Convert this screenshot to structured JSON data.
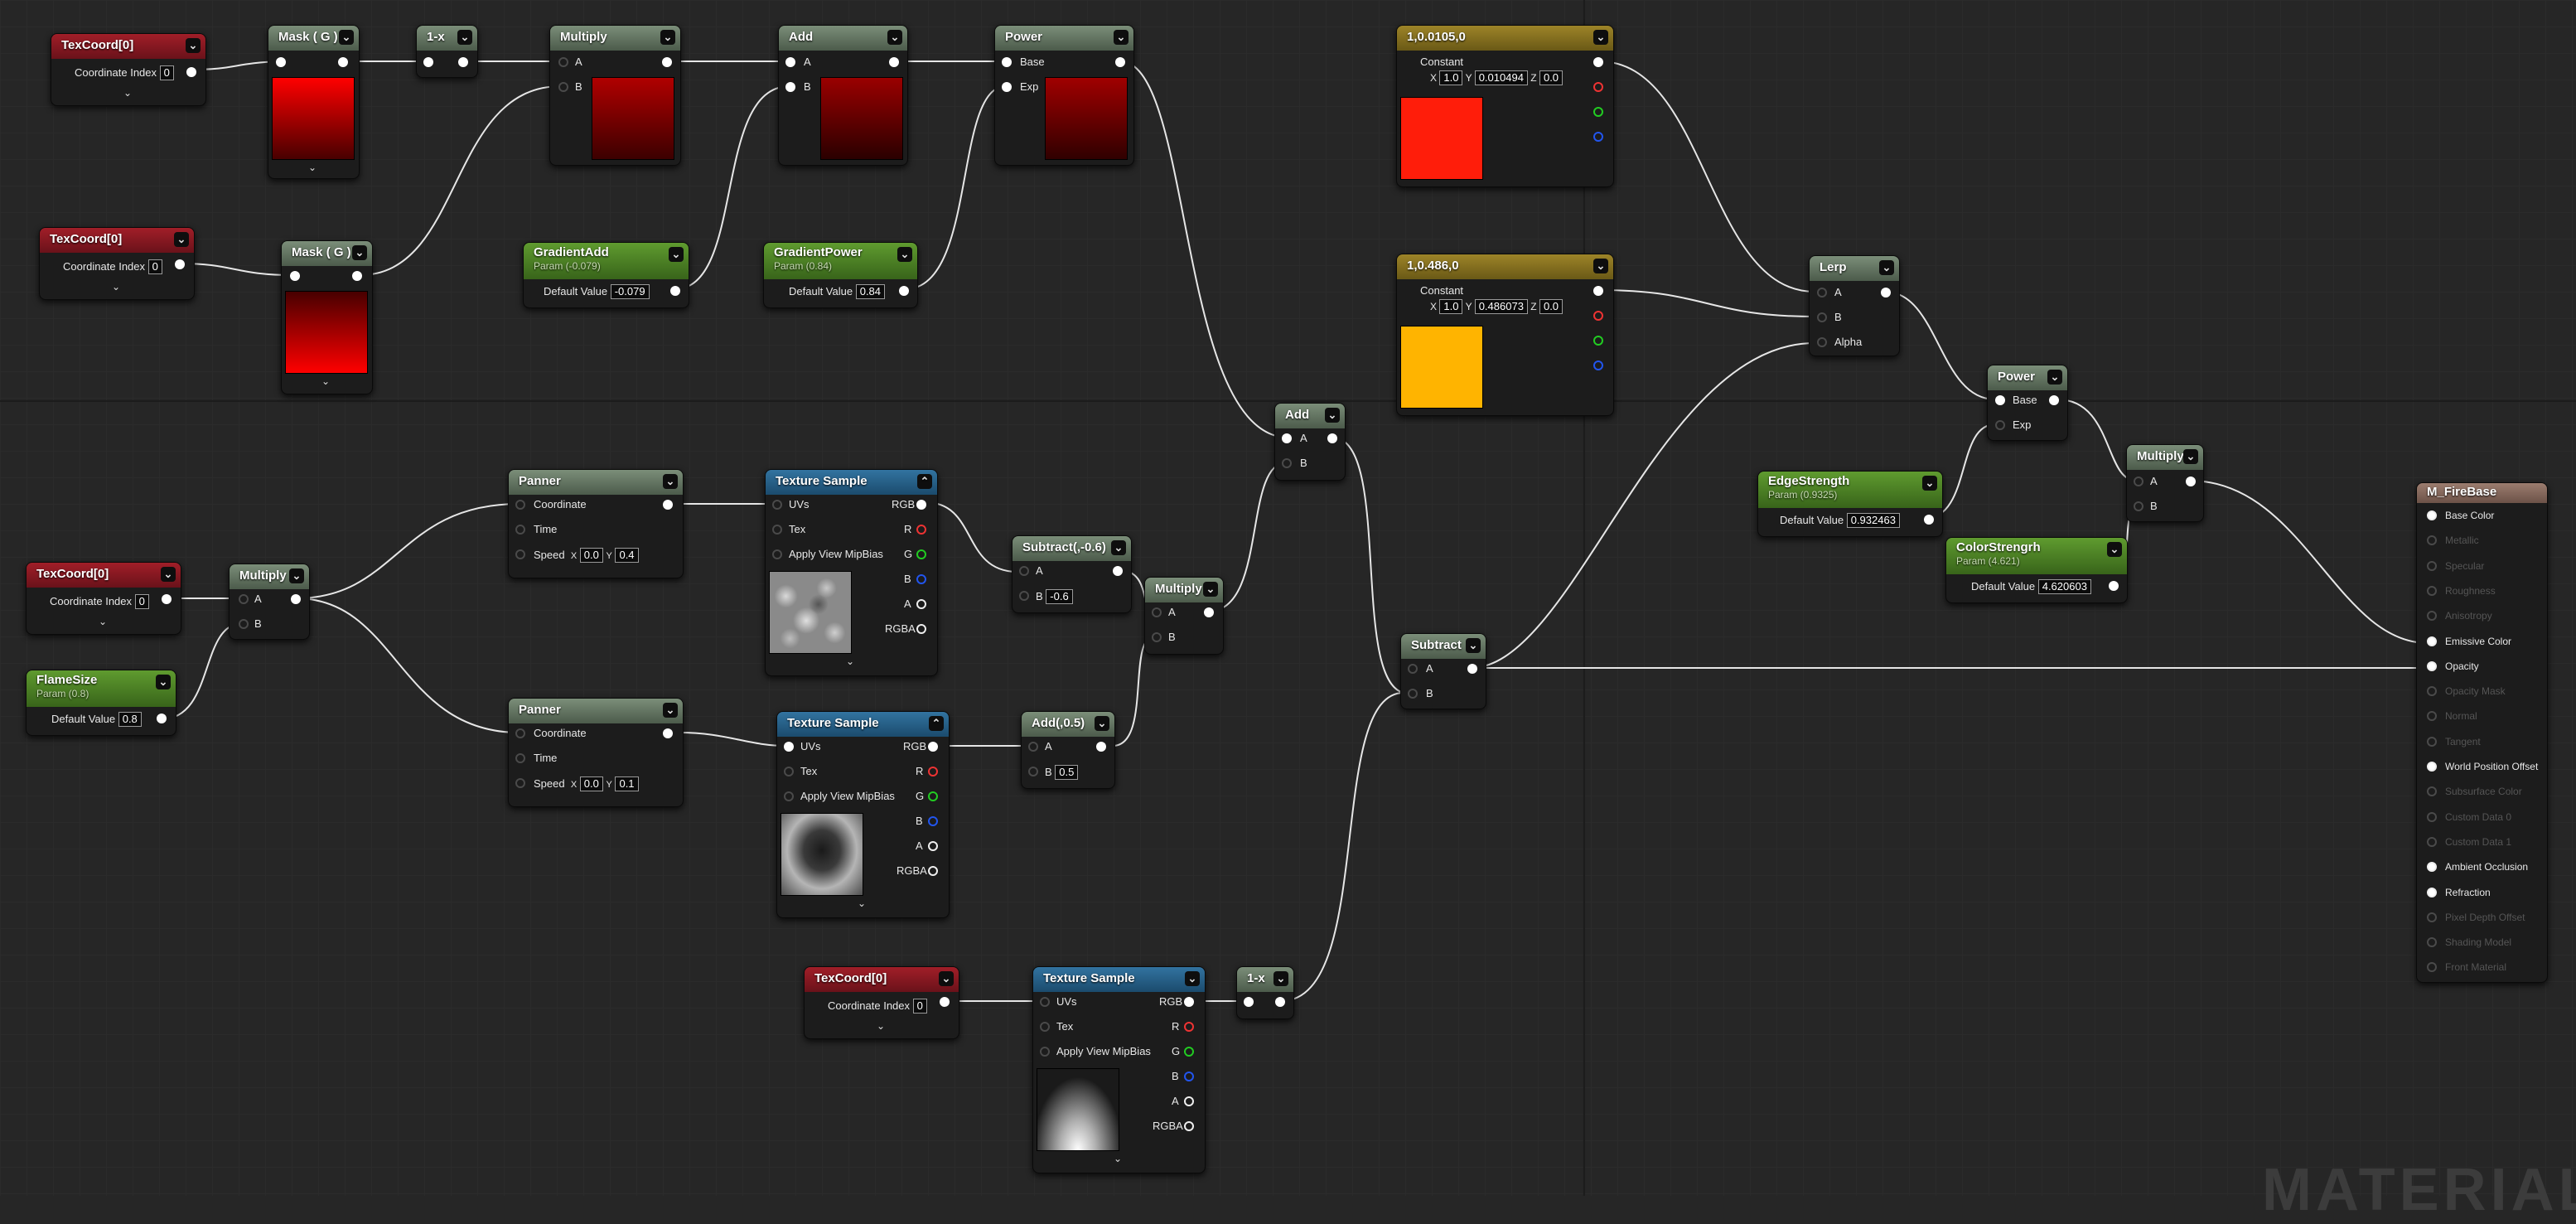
{
  "graph": {
    "watermark": "MATERIAL"
  },
  "nodes": {
    "texcoord_a": {
      "title": "TexCoord[0]",
      "index_label": "Coordinate Index",
      "index_value": "0"
    },
    "texcoord_b": {
      "title": "TexCoord[0]",
      "index_label": "Coordinate Index",
      "index_value": "0"
    },
    "texcoord_c": {
      "title": "TexCoord[0]",
      "index_label": "Coordinate Index",
      "index_value": "0"
    },
    "texcoord_d": {
      "title": "TexCoord[0]",
      "index_label": "Coordinate Index",
      "index_value": "0"
    },
    "mask_a": {
      "title": "Mask ( G )"
    },
    "mask_b": {
      "title": "Mask ( G )"
    },
    "one_minus_a": {
      "title": "1-x"
    },
    "one_minus_b": {
      "title": "1-x"
    },
    "multiply_top": {
      "title": "Multiply",
      "pin_a": "A",
      "pin_b": "B"
    },
    "add_top": {
      "title": "Add",
      "pin_a": "A",
      "pin_b": "B"
    },
    "power_top": {
      "title": "Power",
      "pin_base": "Base",
      "pin_exp": "Exp"
    },
    "gradient_add": {
      "title": "GradientAdd",
      "subtitle": "Param (-0.079)",
      "label": "Default Value",
      "value": "-0.079"
    },
    "gradient_power": {
      "title": "GradientPower",
      "subtitle": "Param (0.84)",
      "label": "Default Value",
      "value": "0.84"
    },
    "const_red": {
      "title": "1,0.0105,0",
      "label": "Constant",
      "x_label": "X",
      "x": "1.0",
      "y_label": "Y",
      "y": "0.010494",
      "z_label": "Z",
      "z": "0.0",
      "swatch": "#ff1d0a"
    },
    "const_orange": {
      "title": "1,0.486,0",
      "label": "Constant",
      "x_label": "X",
      "x": "1.0",
      "y_label": "Y",
      "y": "0.486073",
      "z_label": "Z",
      "z": "0.0",
      "swatch": "#ffb400"
    },
    "lerp": {
      "title": "Lerp",
      "pin_a": "A",
      "pin_b": "B",
      "pin_alpha": "Alpha"
    },
    "power_right": {
      "title": "Power",
      "pin_base": "Base",
      "pin_exp": "Exp"
    },
    "multiply_right": {
      "title": "Multiply",
      "pin_a": "A",
      "pin_b": "B"
    },
    "edge_strength": {
      "title": "EdgeStrength",
      "subtitle": "Param (0.9325)",
      "label": "Default Value",
      "value": "0.932463"
    },
    "color_strength": {
      "title": "ColorStrengrh",
      "subtitle": "Param (4.621)",
      "label": "Default Value",
      "value": "4.620603"
    },
    "add_mid": {
      "title": "Add",
      "pin_a": "A",
      "pin_b": "B"
    },
    "subtract_mid": {
      "title": "Subtract",
      "pin_a": "A",
      "pin_b": "B"
    },
    "panner_a": {
      "title": "Panner",
      "coord": "Coordinate",
      "time": "Time",
      "speed": "Speed",
      "x_label": "X",
      "x": "0.0",
      "y_label": "Y",
      "y": "0.4"
    },
    "panner_b": {
      "title": "Panner",
      "coord": "Coordinate",
      "time": "Time",
      "speed": "Speed",
      "x_label": "X",
      "x": "0.0",
      "y_label": "Y",
      "y": "0.1"
    },
    "multiply_left": {
      "title": "Multiply",
      "pin_a": "A",
      "pin_b": "B"
    },
    "flame_size": {
      "title": "FlameSize",
      "subtitle": "Param (0.8)",
      "label": "Default Value",
      "value": "0.8"
    },
    "subtract_const": {
      "title": "Subtract(,-0.6)",
      "pin_a": "A",
      "pin_b": "B",
      "b_value": "-0.6"
    },
    "add_const": {
      "title": "Add(,0.5)",
      "pin_a": "A",
      "pin_b": "B",
      "b_value": "0.5"
    },
    "multiply_mid": {
      "title": "Multiply",
      "pin_a": "A",
      "pin_b": "B"
    },
    "tex_sample_a": {
      "title": "Texture Sample",
      "uvs": "UVs",
      "tex": "Tex",
      "mip": "Apply View MipBias",
      "rgb": "RGB",
      "r": "R",
      "g": "G",
      "b": "B",
      "a": "A",
      "rgba": "RGBA"
    },
    "tex_sample_b": {
      "title": "Texture Sample",
      "uvs": "UVs",
      "tex": "Tex",
      "mip": "Apply View MipBias",
      "rgb": "RGB",
      "r": "R",
      "g": "G",
      "b": "B",
      "a": "A",
      "rgba": "RGBA"
    },
    "tex_sample_c": {
      "title": "Texture Sample",
      "uvs": "UVs",
      "tex": "Tex",
      "mip": "Apply View MipBias",
      "rgb": "RGB",
      "r": "R",
      "g": "G",
      "b": "B",
      "a": "A",
      "rgba": "RGBA"
    },
    "material": {
      "title": "M_FireBase",
      "inputs": [
        {
          "label": "Base Color",
          "active": true
        },
        {
          "label": "Metallic",
          "active": false
        },
        {
          "label": "Specular",
          "active": false
        },
        {
          "label": "Roughness",
          "active": false
        },
        {
          "label": "Anisotropy",
          "active": false
        },
        {
          "label": "Emissive Color",
          "active": true
        },
        {
          "label": "Opacity",
          "active": true
        },
        {
          "label": "Opacity Mask",
          "active": false
        },
        {
          "label": "Normal",
          "active": false
        },
        {
          "label": "Tangent",
          "active": false
        },
        {
          "label": "World Position Offset",
          "active": true
        },
        {
          "label": "Subsurface Color",
          "active": false
        },
        {
          "label": "Custom Data 0",
          "active": false
        },
        {
          "label": "Custom Data 1",
          "active": false
        },
        {
          "label": "Ambient Occlusion",
          "active": true
        },
        {
          "label": "Refraction",
          "active": true
        },
        {
          "label": "Pixel Depth Offset",
          "active": false
        },
        {
          "label": "Shading Model",
          "active": false
        },
        {
          "label": "Front Material",
          "active": false
        }
      ]
    }
  }
}
